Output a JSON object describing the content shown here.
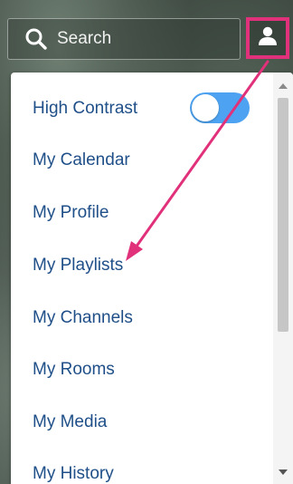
{
  "header": {
    "search_placeholder": "Search",
    "search_icon": "search-icon",
    "user_icon": "user-icon"
  },
  "menu": {
    "items": [
      {
        "label": "High Contrast",
        "has_toggle": true,
        "toggle_on": true
      },
      {
        "label": "My Calendar"
      },
      {
        "label": "My Profile"
      },
      {
        "label": "My Playlists"
      },
      {
        "label": "My Channels"
      },
      {
        "label": "My Rooms"
      },
      {
        "label": "My Media"
      },
      {
        "label": "My History"
      }
    ]
  },
  "colors": {
    "link": "#1f4f88",
    "toggle": "#4da3f1",
    "annotation": "#e0317a"
  }
}
